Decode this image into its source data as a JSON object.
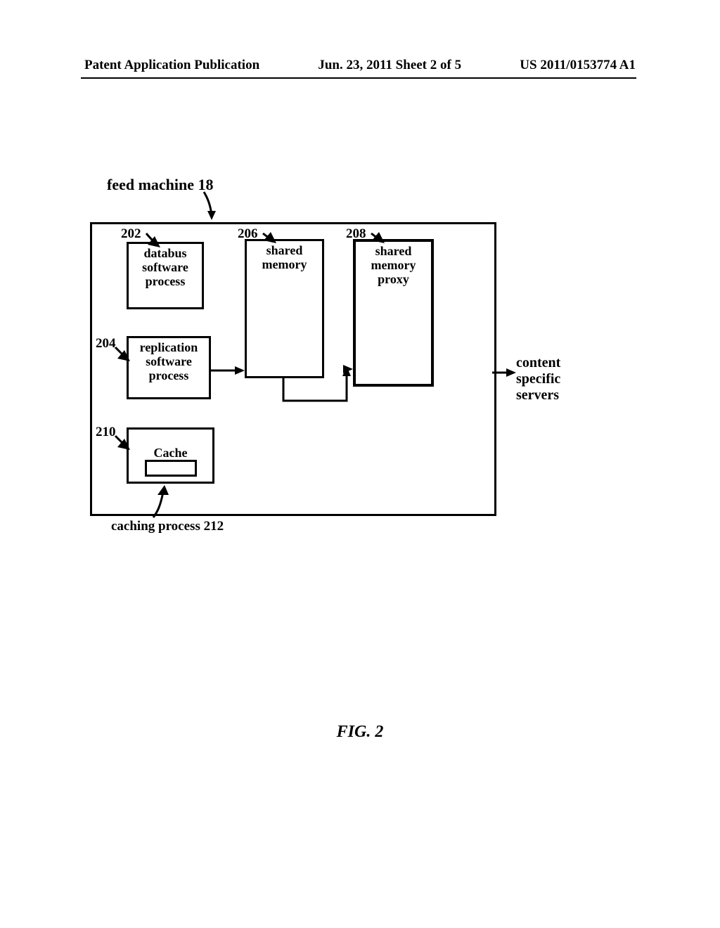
{
  "header": {
    "left": "Patent Application Publication",
    "center": "Jun. 23, 2011  Sheet 2 of 5",
    "right": "US 2011/0153774 A1"
  },
  "labels": {
    "feed_machine": "feed machine 18",
    "content_specific_servers_l1": "content",
    "content_specific_servers_l2": "specific",
    "content_specific_servers_l3": "servers",
    "caching_process": "caching process 212",
    "figure": "FIG. 2"
  },
  "refs": {
    "r202": "202",
    "r204": "204",
    "r206": "206",
    "r208": "208",
    "r210": "210"
  },
  "boxes": {
    "databus_l1": "databus",
    "databus_l2": "software",
    "databus_l3": "process",
    "repl_l1": "replication",
    "repl_l2": "software",
    "repl_l3": "process",
    "shared1_l1": "shared",
    "shared1_l2": "memory",
    "shared2_l1": "shared",
    "shared2_l2": "memory",
    "shared2_l3": "proxy",
    "cache": "Cache"
  }
}
